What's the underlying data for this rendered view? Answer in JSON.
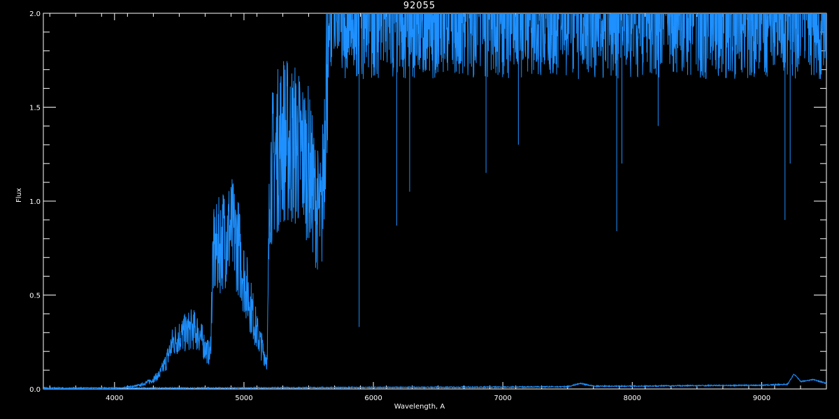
{
  "chart_data": {
    "type": "line",
    "title": "92055",
    "xlabel": "Wavelength, A",
    "ylabel": "Flux",
    "xlim": [
      3450,
      9500
    ],
    "ylim": [
      0,
      2.0
    ],
    "xticks": [
      4000,
      5000,
      6000,
      7000,
      8000,
      9000
    ],
    "xtick_labels": [
      "4000",
      "5000",
      "6000",
      "7000",
      "8000",
      "9000"
    ],
    "yticks": [
      0.0,
      0.5,
      1.0,
      1.5,
      2.0
    ],
    "ytick_labels": [
      "0.0",
      "0.5",
      "1.0",
      "1.5",
      "2.0"
    ],
    "grid": false,
    "background": "#000000",
    "axis_color": "#ffffff",
    "series": [
      {
        "color": "#1e90ff",
        "x": [
          3450,
          3600,
          3800,
          4000,
          4100,
          4200,
          4300,
          4350,
          4400,
          4450,
          4500,
          4550,
          4600,
          4650,
          4700,
          4740,
          4760,
          4800,
          4850,
          4900,
          4950,
          5000,
          5050,
          5100,
          5150,
          5180,
          5200,
          5250,
          5300,
          5350,
          5400,
          5450,
          5500,
          5550,
          5600,
          5650,
          5700,
          5800,
          5900,
          6000,
          6100,
          6200,
          6300,
          6400,
          6500,
          6600,
          6700,
          6800,
          6900,
          7000,
          7100,
          7200,
          7300,
          7400,
          7500,
          7600,
          7700,
          7800,
          7900,
          8000,
          8100,
          8200,
          8300,
          8400,
          8500,
          8600,
          8700,
          8800,
          8900,
          9000,
          9100,
          9150,
          9200,
          9250,
          9300,
          9400,
          9500
        ],
        "y": [
          0.0,
          0.0,
          0.0,
          0.0,
          0.01,
          0.02,
          0.05,
          0.08,
          0.15,
          0.25,
          0.28,
          0.3,
          0.32,
          0.3,
          0.22,
          0.18,
          0.7,
          0.75,
          0.82,
          0.85,
          0.78,
          0.6,
          0.45,
          0.3,
          0.2,
          0.15,
          1.15,
          1.25,
          1.35,
          1.3,
          1.3,
          1.25,
          1.2,
          1.0,
          0.9,
          2.0,
          2.0,
          2.0,
          2.0,
          2.0,
          2.0,
          2.0,
          2.0,
          2.0,
          2.0,
          2.0,
          2.0,
          2.0,
          2.0,
          2.0,
          2.0,
          2.0,
          2.0,
          2.0,
          2.0,
          2.0,
          2.0,
          2.0,
          2.0,
          2.0,
          2.0,
          2.0,
          2.0,
          2.0,
          2.0,
          2.0,
          2.0,
          2.0,
          2.0,
          2.0,
          2.0,
          2.0,
          2.0,
          2.0,
          2.0,
          2.0,
          2.0
        ]
      },
      {
        "color": "#1e90ff",
        "x": [
          3450,
          4000,
          4500,
          5000,
          5500,
          6000,
          6500,
          7000,
          7500,
          7600,
          7700,
          8000,
          8500,
          9000,
          9200,
          9250,
          9300,
          9400,
          9500
        ],
        "y": [
          0.005,
          0.005,
          0.005,
          0.006,
          0.007,
          0.008,
          0.009,
          0.01,
          0.012,
          0.03,
          0.015,
          0.015,
          0.018,
          0.02,
          0.025,
          0.08,
          0.04,
          0.05,
          0.03
        ]
      }
    ],
    "absorption_lines": [
      {
        "x": 5890,
        "y": 0.33
      },
      {
        "x": 6180,
        "y": 0.87
      },
      {
        "x": 6280,
        "y": 1.05
      },
      {
        "x": 6870,
        "y": 1.15
      },
      {
        "x": 7120,
        "y": 1.3
      },
      {
        "x": 7880,
        "y": 0.84
      },
      {
        "x": 7920,
        "y": 1.2
      },
      {
        "x": 8200,
        "y": 1.4
      },
      {
        "x": 9180,
        "y": 0.9
      },
      {
        "x": 9220,
        "y": 1.2
      }
    ]
  }
}
